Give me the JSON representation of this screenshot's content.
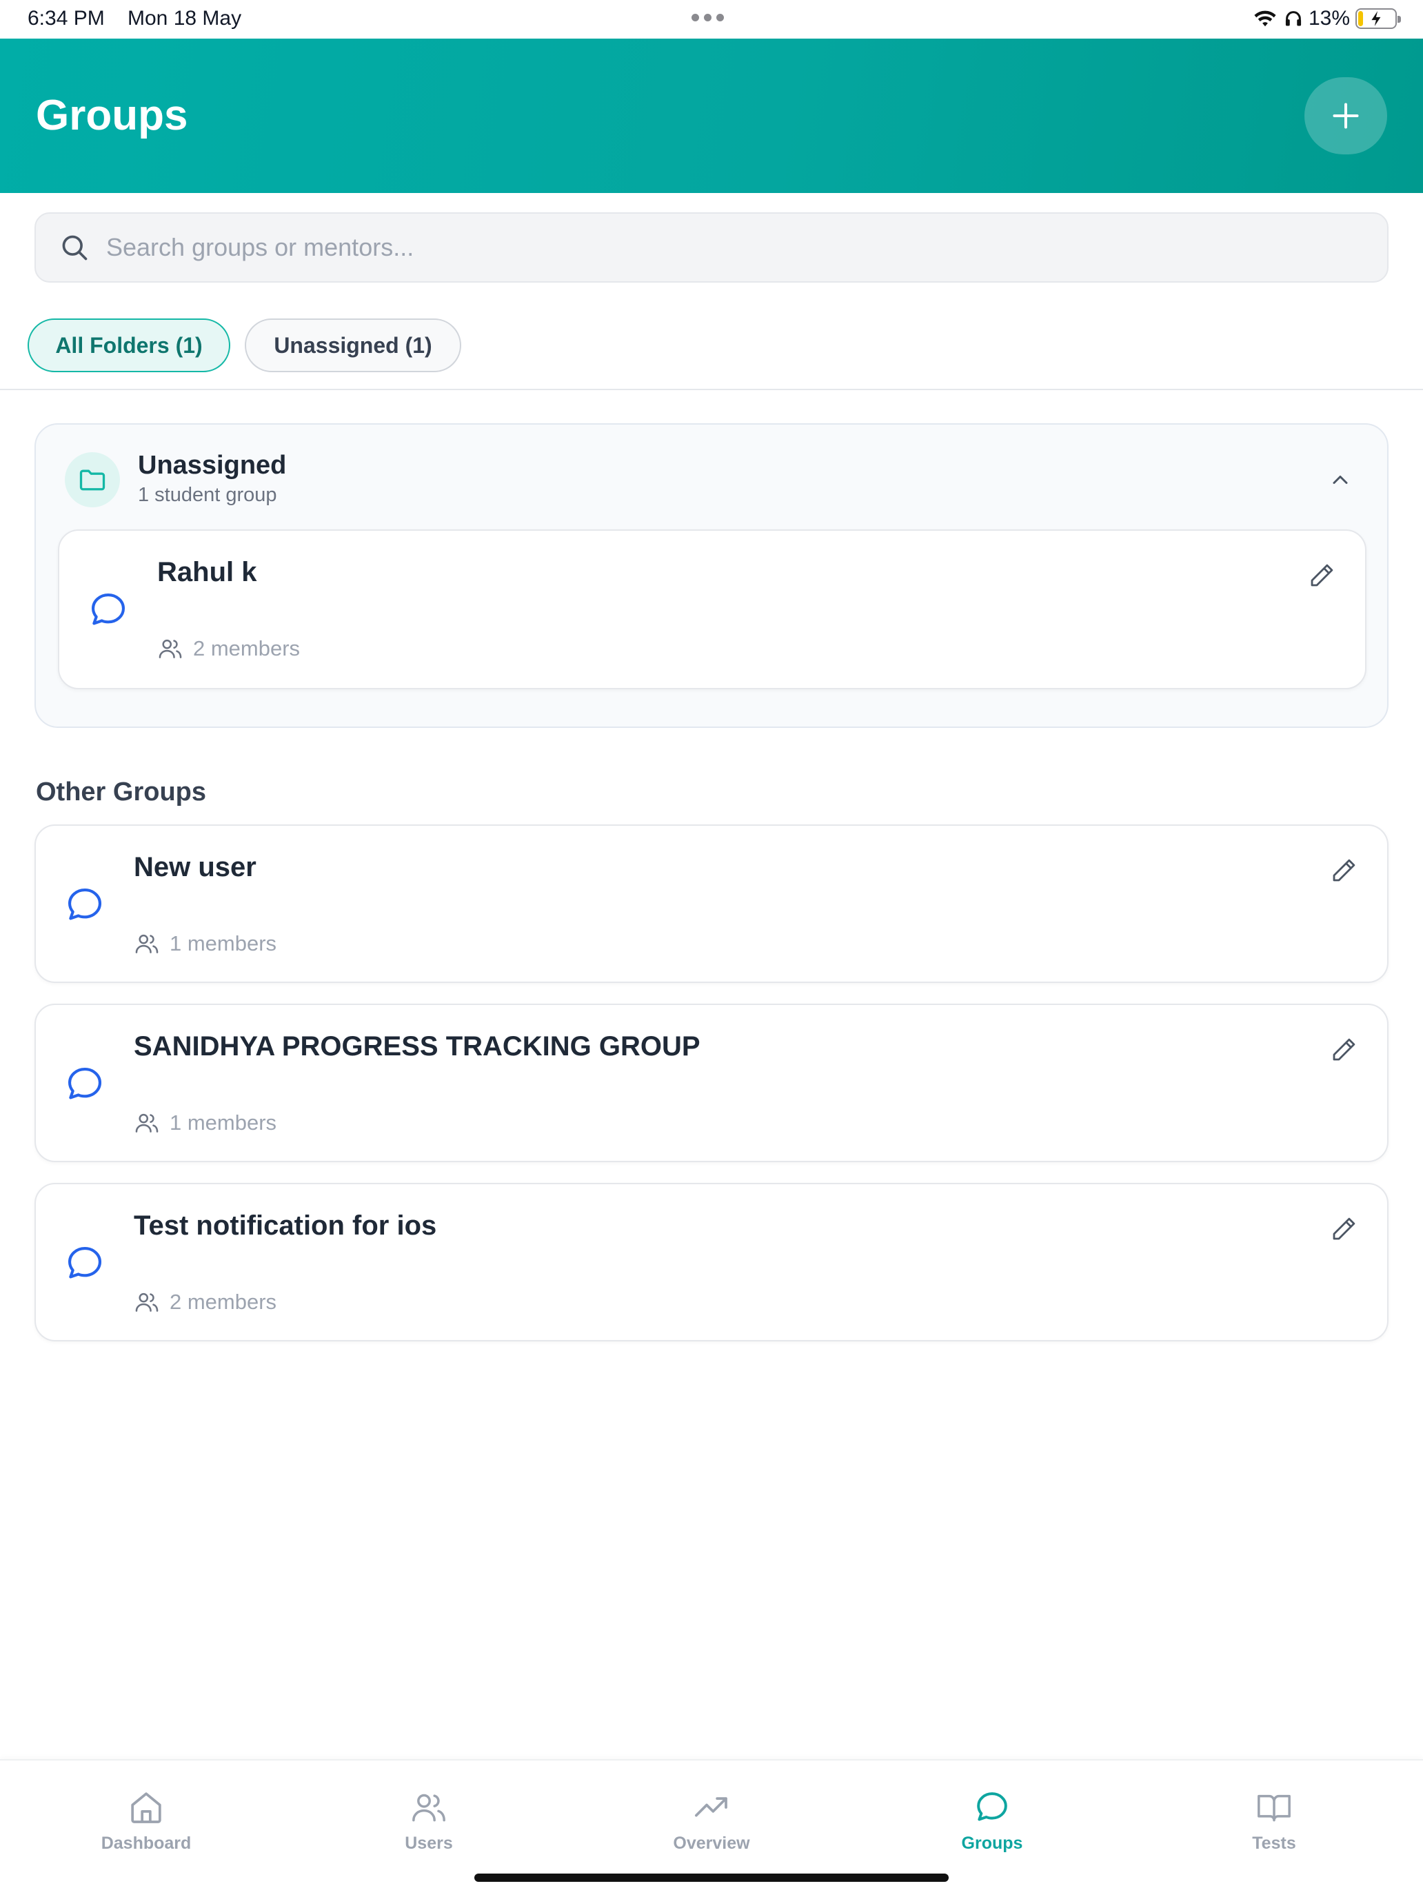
{
  "status_bar": {
    "time": "6:34 PM",
    "date": "Mon 18 May",
    "battery": "13%",
    "battery_level": 0.13
  },
  "header": {
    "title": "Groups",
    "add_icon": "plus-icon"
  },
  "search": {
    "placeholder": "Search groups or mentors...",
    "value": ""
  },
  "filters": [
    {
      "label": "All Folders (1)",
      "active": true
    },
    {
      "label": "Unassigned (1)",
      "active": false
    }
  ],
  "folder": {
    "name": "Unassigned",
    "subtitle": "1 student group",
    "groups": [
      {
        "name": "Rahul k",
        "members": "2 members"
      }
    ]
  },
  "other_groups": {
    "title": "Other Groups",
    "items": [
      {
        "name": "New user",
        "members": "1 members"
      },
      {
        "name": "SANIDHYA PROGRESS TRACKING GROUP",
        "members": "1 members"
      },
      {
        "name": "Test notification for ios",
        "members": "2 members"
      }
    ]
  },
  "nav": [
    {
      "label": "Dashboard",
      "icon": "home-icon",
      "active": false
    },
    {
      "label": "Users",
      "icon": "users-icon",
      "active": false
    },
    {
      "label": "Overview",
      "icon": "trending-up-icon",
      "active": false
    },
    {
      "label": "Groups",
      "icon": "chat-bubble-icon",
      "active": true
    },
    {
      "label": "Tests",
      "icon": "book-open-icon",
      "active": false
    }
  ],
  "colors": {
    "brand": "#01ada7",
    "accent": "#14b8a6",
    "chat_icon": "#2563eb",
    "active_nav": "#0ea5a0"
  }
}
